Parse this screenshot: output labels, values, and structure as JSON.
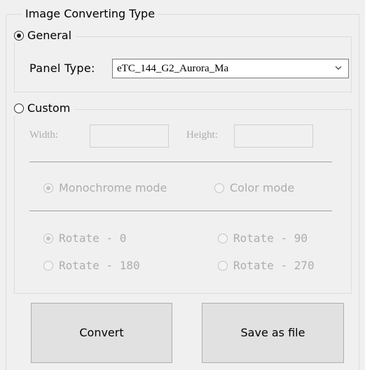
{
  "group_title": "Image Converting Type",
  "general": {
    "label": "General",
    "selected": true,
    "panel_type_label": "Panel Type:",
    "panel_type_value": "eTC_144_G2_Aurora_Ma"
  },
  "custom": {
    "label": "Custom",
    "selected": false,
    "width_label": "Width:",
    "height_label": "Height:",
    "width_value": "",
    "height_value": "",
    "modes": [
      {
        "label": "Monochrome mode",
        "selected": true
      },
      {
        "label": "Color mode",
        "selected": false
      }
    ],
    "rotations": [
      {
        "label": "Rotate - 0",
        "selected": true
      },
      {
        "label": "Rotate - 90",
        "selected": false
      },
      {
        "label": "Rotate - 180",
        "selected": false
      },
      {
        "label": "Rotate - 270",
        "selected": false
      }
    ]
  },
  "buttons": {
    "convert": "Convert",
    "save": "Save as file"
  },
  "colors": {
    "window_bg": "#f0f0f0",
    "disabled_text": "#adadad",
    "button_bg": "#e1e1e1",
    "button_border": "#adadad"
  },
  "icons": {
    "dropdown": "chevron-down-icon"
  }
}
